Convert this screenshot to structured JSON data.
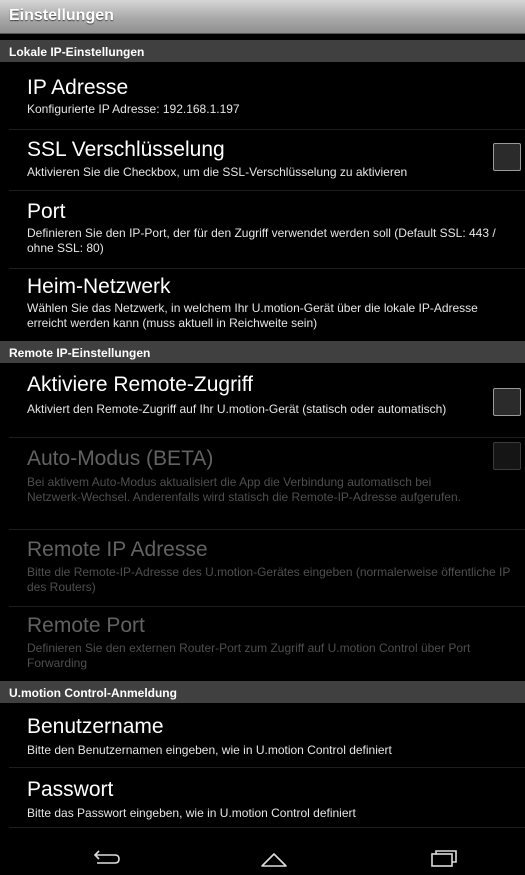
{
  "header": {
    "title": "Einstellungen"
  },
  "sections": [
    {
      "label": "Lokale IP-Einstellungen"
    },
    {
      "label": "Remote IP-Einstellungen"
    },
    {
      "label": "U.motion Control-Anmeldung"
    }
  ],
  "items": [
    {
      "title": "IP Adresse",
      "summary": "Konfigurierte IP Adresse: 192.168.1.197",
      "enabled": true,
      "has_checkbox": false
    },
    {
      "title": "SSL Verschlüsselung",
      "summary": "Aktivieren Sie die Checkbox, um die SSL-Verschlüsselung zu aktivieren",
      "enabled": true,
      "has_checkbox": true,
      "checked": false
    },
    {
      "title": "Port",
      "summary": "Definieren Sie den IP-Port, der für den Zugriff verwendet werden soll (Default SSL: 443 / ohne SSL: 80)",
      "enabled": true,
      "has_checkbox": false
    },
    {
      "title": "Heim-Netzwerk",
      "summary": "Wählen Sie das Netzwerk, in welchem Ihr U.motion-Gerät über die lokale IP-Adresse erreicht werden kann (muss aktuell in Reichweite sein)",
      "enabled": true,
      "has_checkbox": false
    },
    {
      "title": "Aktiviere Remote-Zugriff",
      "summary": "Aktiviert den Remote-Zugriff auf Ihr U.motion-Gerät (statisch oder automatisch)",
      "enabled": true,
      "has_checkbox": true,
      "checked": false
    },
    {
      "title": "Auto-Modus (BETA)",
      "summary": "Bei aktivem Auto-Modus aktualisiert die App die Verbindung automatisch bei Netzwerk-Wechsel. Anderenfalls wird statisch die Remote-IP-Adresse aufgerufen.",
      "enabled": false,
      "has_checkbox": true,
      "checked": false
    },
    {
      "title": "Remote IP Adresse",
      "summary": "Bitte die Remote-IP-Adresse des U.motion-Gerätes eingeben (normalerweise öffentliche IP des Routers)",
      "enabled": false,
      "has_checkbox": false
    },
    {
      "title": "Remote Port",
      "summary": "Definieren Sie den externen Router-Port zum Zugriff auf U.motion Control über Port Forwarding",
      "enabled": false,
      "has_checkbox": false
    },
    {
      "title": "Benutzername",
      "summary": "Bitte den Benutzernamen eingeben, wie in U.motion Control definiert",
      "enabled": true,
      "has_checkbox": false
    },
    {
      "title": "Passwort",
      "summary": "Bitte das Passwort eingeben, wie in U.motion Control definiert",
      "enabled": true,
      "has_checkbox": false
    }
  ],
  "navbar": {
    "buttons": [
      "back-icon",
      "home-icon",
      "recent-apps-icon"
    ]
  }
}
